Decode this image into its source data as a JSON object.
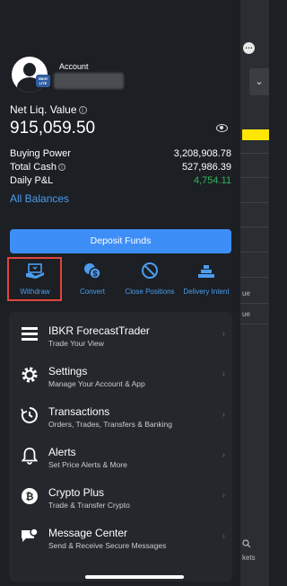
{
  "account": {
    "label": "Account",
    "badge": "IBKR LITE"
  },
  "summary": {
    "nlv_label": "Net Liq. Value",
    "nlv_value": "915,059.50",
    "metrics": [
      {
        "label": "Buying Power",
        "value": "3,208,908.78",
        "info": false
      },
      {
        "label": "Total Cash",
        "value": "527,986.39",
        "info": true
      },
      {
        "label": "Daily P&L",
        "value": "4,754.11",
        "info": false
      }
    ],
    "all_balances": "All Balances"
  },
  "deposit_label": "Deposit Funds",
  "actions": [
    {
      "label": "Withdraw",
      "icon": "withdraw-icon"
    },
    {
      "label": "Convert",
      "icon": "convert-icon"
    },
    {
      "label": "Close Positions",
      "icon": "close-positions-icon"
    },
    {
      "label": "Delivery Intent",
      "icon": "delivery-intent-icon"
    }
  ],
  "menu": [
    {
      "title": "IBKR ForecastTrader",
      "subtitle": "Trade Your View",
      "icon": "forecast-icon"
    },
    {
      "title": "Settings",
      "subtitle": "Manage Your Account & App",
      "icon": "gear-icon"
    },
    {
      "title": "Transactions",
      "subtitle": "Orders, Trades, Transfers & Banking",
      "icon": "transactions-icon"
    },
    {
      "title": "Alerts",
      "subtitle": "Set Price Alerts & More",
      "icon": "bell-icon"
    },
    {
      "title": "Crypto Plus",
      "subtitle": "Trade & Transfer Crypto",
      "icon": "bitcoin-icon"
    },
    {
      "title": "Message Center",
      "subtitle": "Send & Receive Secure Messages",
      "icon": "message-icon"
    }
  ],
  "background": {
    "snippets": [
      "ue",
      "ue",
      "kets"
    ]
  },
  "colors": {
    "accent": "#3e8ef7",
    "link": "#4a9df0",
    "positive": "#2fb45a",
    "highlight": "#e0463c"
  }
}
